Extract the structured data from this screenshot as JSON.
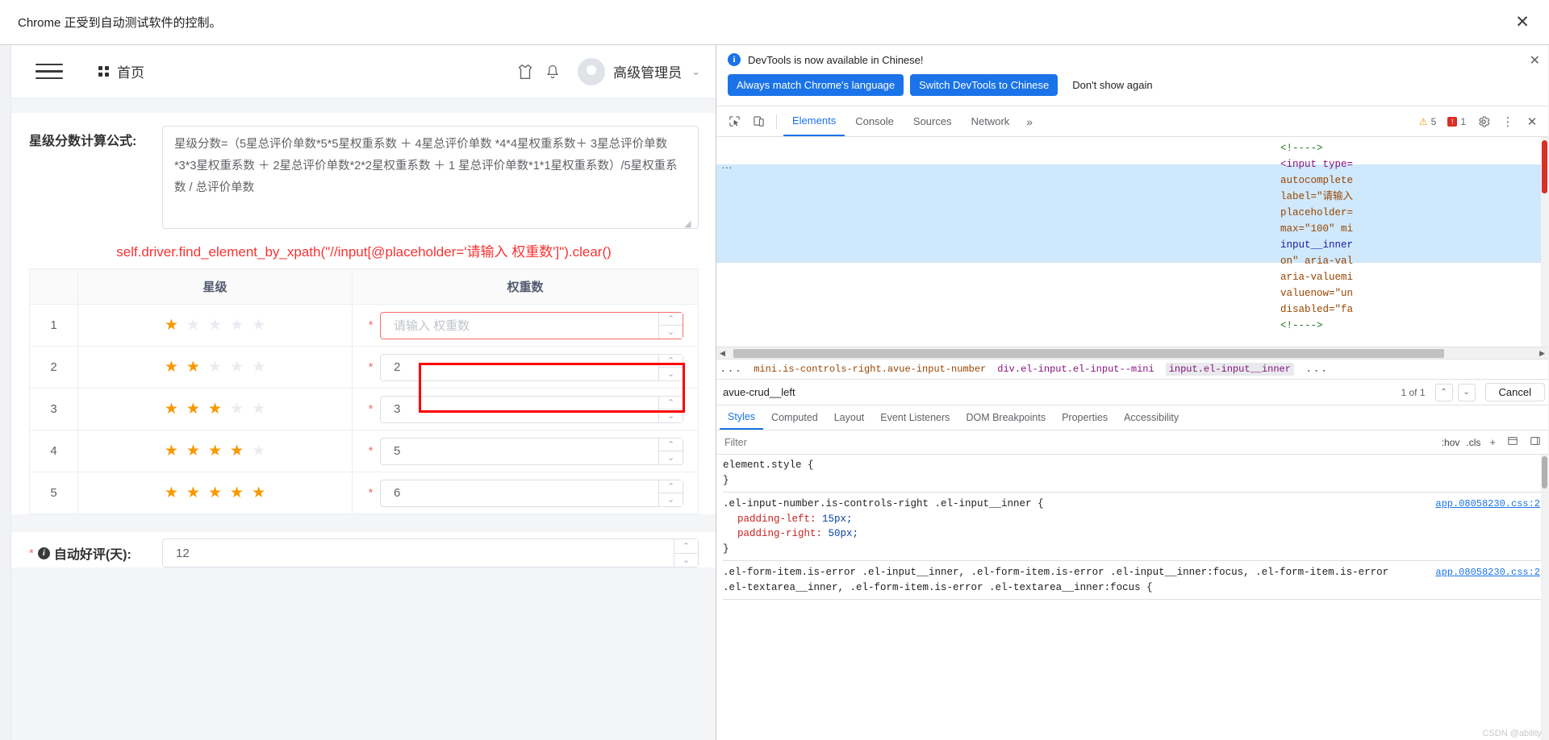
{
  "infobar": {
    "message": "Chrome 正受到自动测试软件的控制。",
    "close_icon": "close-icon"
  },
  "page": {
    "topnav": {
      "menu_icon": "hamburger-icon",
      "grid_icon": "grid-icon",
      "home_label": "首页",
      "shirt_icon": "shirt-icon",
      "bell_icon": "bell-icon",
      "user_name": "高级管理员",
      "caret": "⌄"
    },
    "formula": {
      "label": "星级分数计算公式:",
      "value": "星级分数=（5星总评价单数*5*5星权重系数 ＋ 4星总评价单数 *4*4星权重系数＋ 3星总评价单数*3*3星权重系数 ＋ 2星总评价单数*2*2星权重系数 ＋ 1 星总评价单数*1*1星权重系数）/5星权重系数 / 总评价单数"
    },
    "xpath_note": "self.driver.find_element_by_xpath(\"//input[@placeholder='请输入 权重数']\").clear()",
    "table": {
      "headers": [
        "",
        "星级",
        "权重数"
      ],
      "rows": [
        {
          "index": "1",
          "stars": 1,
          "value": "",
          "placeholder": "请输入 权重数",
          "required": "*",
          "error": true
        },
        {
          "index": "2",
          "stars": 2,
          "value": "2",
          "placeholder": "请输入 权重数",
          "required": "*",
          "error": false
        },
        {
          "index": "3",
          "stars": 3,
          "value": "3",
          "placeholder": "请输入 权重数",
          "required": "*",
          "error": false
        },
        {
          "index": "4",
          "stars": 4,
          "value": "5",
          "placeholder": "请输入 权重数",
          "required": "*",
          "error": false
        },
        {
          "index": "5",
          "stars": 5,
          "value": "6",
          "placeholder": "请输入 权重数",
          "required": "*",
          "error": false
        }
      ],
      "star_total": 5,
      "star_glyph": "★"
    },
    "auto_review": {
      "required": "*",
      "info_icon": "info-icon",
      "label": "自动好评(天):",
      "value": "12"
    }
  },
  "devtools": {
    "banner": {
      "icon": "info-icon",
      "message": "DevTools is now available in Chinese!",
      "btn_always": "Always match Chrome's language",
      "btn_switch": "Switch DevTools to Chinese",
      "btn_dismiss": "Don't show again",
      "close_icon": "close-icon"
    },
    "toolbar": {
      "inspect_icon": "inspect-cursor-icon",
      "device_icon": "device-toolbar-icon",
      "tabs": [
        "Elements",
        "Console",
        "Sources",
        "Network"
      ],
      "active_tab": "Elements",
      "more_icon": "chevron-double-right-icon",
      "warning_count": "5",
      "error_count": "1",
      "settings_icon": "gear-icon",
      "kebab_icon": "more-vertical-icon",
      "close_icon": "close-icon"
    },
    "elements_code": [
      {
        "text": "<!---->",
        "cls": "c-cmt"
      },
      {
        "text": "<input type=",
        "cls": "c-tag"
      },
      {
        "text": "autocomplete",
        "cls": "c-attr"
      },
      {
        "text": "label=\"请输入",
        "cls": "c-attr"
      },
      {
        "text": "placeholder=",
        "cls": "c-attr"
      },
      {
        "text": "max=\"100\" mi",
        "cls": "c-attr"
      },
      {
        "text": "input__inner",
        "cls": "c-val"
      },
      {
        "text": "on\" aria-val",
        "cls": "c-attr"
      },
      {
        "text": "aria-valuemi",
        "cls": "c-attr"
      },
      {
        "text": "valuenow=\"un",
        "cls": "c-attr"
      },
      {
        "text": "disabled=\"fa",
        "cls": "c-attr"
      },
      {
        "text": "<!---->",
        "cls": "c-cmt"
      }
    ],
    "breadcrumb": [
      {
        "text": "...",
        "type": "dots"
      },
      {
        "text": "mini.is-controls-right.avue-input-number",
        "type": "orange"
      },
      {
        "text": "div.el-input.el-input--mini",
        "type": "purple"
      },
      {
        "text": "input.el-input__inner",
        "type": "sel"
      },
      {
        "text": "...",
        "type": "dots"
      }
    ],
    "find": {
      "value": "avue-crud__left",
      "count": "1 of 1",
      "prev_icon": "chevron-up-icon",
      "next_icon": "chevron-down-icon",
      "cancel_label": "Cancel"
    },
    "style_tabs": [
      "Styles",
      "Computed",
      "Layout",
      "Event Listeners",
      "DOM Breakpoints",
      "Properties",
      "Accessibility"
    ],
    "active_style_tab": "Styles",
    "filter": {
      "placeholder": "Filter",
      "hov_label": ":hov",
      "cls_label": ".cls",
      "plus_icon": "plus-icon",
      "layers_icon": "layers-icon",
      "sidebar_icon": "sidebar-toggle-icon"
    },
    "rules": [
      {
        "selector": "element.style {",
        "close": "}",
        "source": "",
        "declarations": []
      },
      {
        "selector": ".el-input-number.is-controls-right .el-input__inner {",
        "close": "}",
        "source": "app.08058230.css:2",
        "declarations": [
          {
            "prop": "padding-left",
            "value": "15px;"
          },
          {
            "prop": "padding-right",
            "value": "50px;"
          }
        ]
      },
      {
        "selector": ".el-form-item.is-error .el-input__inner, .el-form-item.is-error .el-input__inner:focus, .el-form-item.is-error .el-textarea__inner, .el-form-item.is-error .el-textarea__inner:focus {",
        "close": "",
        "source": "app.08058230.css:2",
        "declarations": []
      }
    ],
    "watermark": "CSDN @ability"
  }
}
